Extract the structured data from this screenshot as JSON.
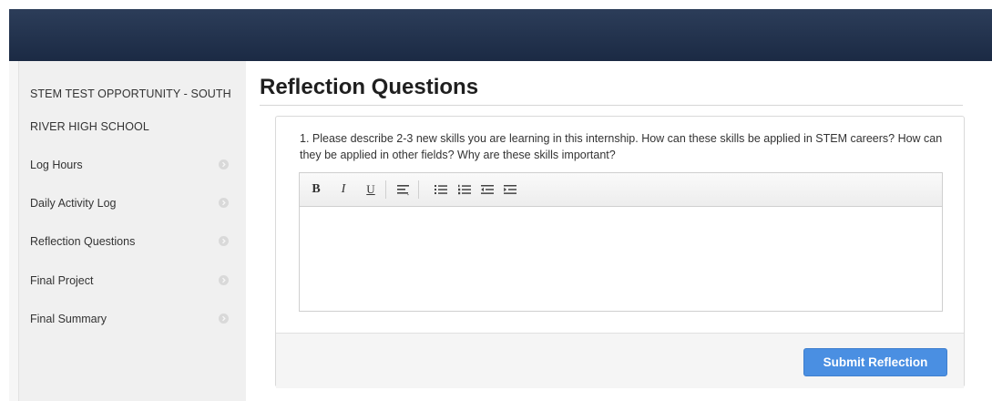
{
  "sidebar": {
    "title_line1": "STEM TEST OPPORTUNITY - SOUTH",
    "title_line2": "RIVER HIGH SCHOOL",
    "items": [
      {
        "label": "Log Hours"
      },
      {
        "label": "Daily Activity Log"
      },
      {
        "label": "Reflection Questions"
      },
      {
        "label": "Final Project"
      },
      {
        "label": "Final Summary"
      }
    ]
  },
  "main": {
    "title": "Reflection Questions",
    "question": "1. Please describe 2-3 new skills you are learning in this internship. How can these skills be applied in STEM careers? How can they be applied in other fields? Why are these skills important?",
    "toolbar": {
      "bold": "B",
      "italic": "I",
      "underline": "U"
    },
    "submit_label": "Submit Reflection"
  },
  "colors": {
    "header": "#1f2f4b",
    "sidebar_bg": "#f0f0f0",
    "submit": "#4a8fe2"
  },
  "icons": [
    "align-left-icon",
    "bullet-list-icon",
    "numbered-list-icon",
    "outdent-icon",
    "indent-icon",
    "chevron-right-icon"
  ]
}
